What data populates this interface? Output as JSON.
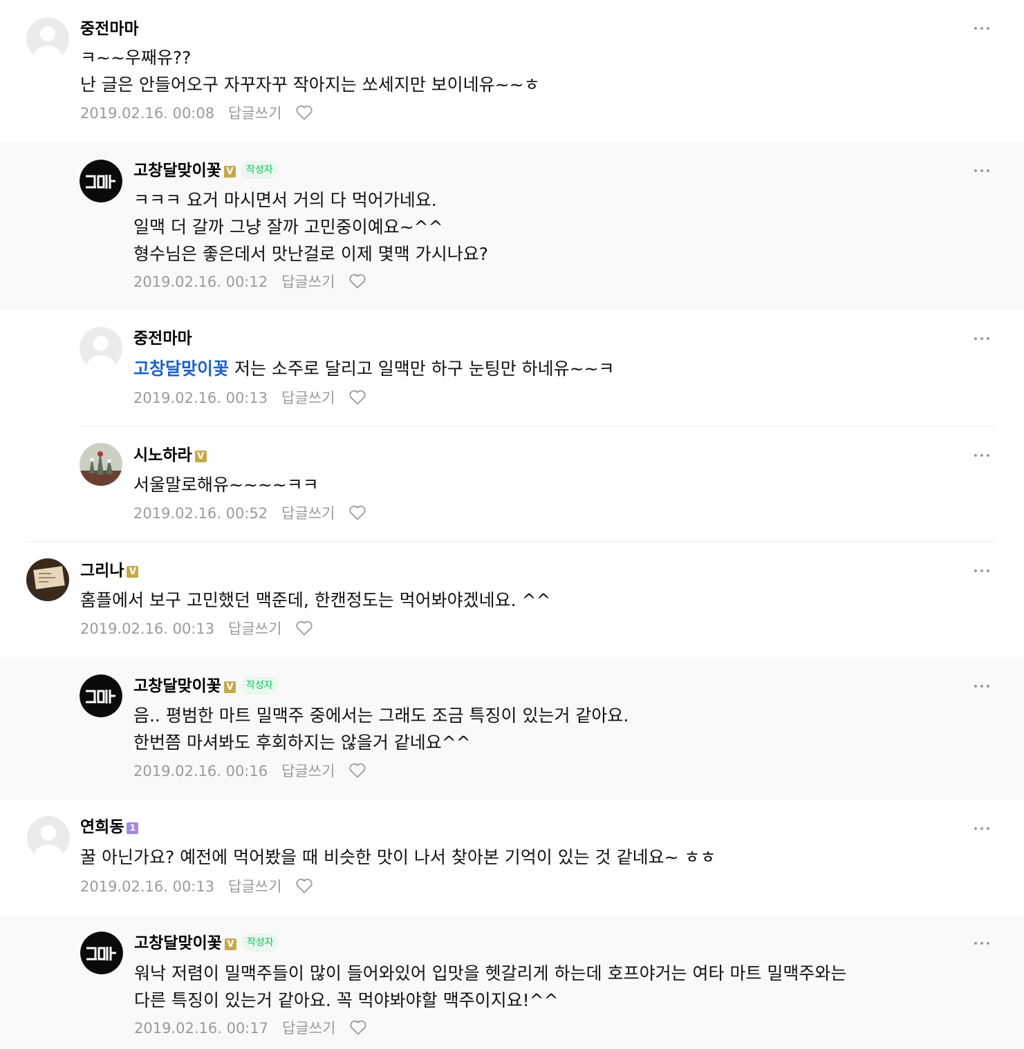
{
  "colors": {
    "reply_bg": "#f9f9f9",
    "mention": "#1a62cf",
    "author_tag": "#03c75a",
    "meta": "#9a9a9a"
  },
  "comments": [
    {
      "nick": "중전마마",
      "badge": "",
      "author_tag": "",
      "mention": "",
      "lines": [
        "ㅋ~~우째유??",
        "난 글은 안들어오구 자꾸자꾸 작아지는 쏘세지만 보이네유~~ㅎ"
      ],
      "date": "2019.02.16. 00:08",
      "reply": "답글쓰기"
    },
    {
      "nick": "고창달맞이꽃",
      "badge": "V",
      "author_tag": "작성자",
      "mention": "",
      "lines": [
        "ㅋㅋㅋ 요거 마시면서 거의 다 먹어가네요.",
        "일맥 더 갈까 그냥 잘까 고민중이예요~^^",
        "형수님은 좋은데서 맛난걸로 이제 몇맥 가시나요?"
      ],
      "date": "2019.02.16. 00:12",
      "reply": "답글쓰기"
    },
    {
      "nick": "중전마마",
      "badge": "",
      "author_tag": "",
      "mention": "고창달맞이꽃",
      "lines": [
        "저는 소주로 달리고 일맥만 하구 눈팅만 하네유~~ㅋ"
      ],
      "date": "2019.02.16. 00:13",
      "reply": "답글쓰기"
    },
    {
      "nick": "시노하라",
      "badge": "V",
      "author_tag": "",
      "mention": "",
      "lines": [
        "서울말로해유~~~~ㅋㅋ"
      ],
      "date": "2019.02.16. 00:52",
      "reply": "답글쓰기"
    },
    {
      "nick": "그리나",
      "badge": "V",
      "author_tag": "",
      "mention": "",
      "lines": [
        "홈플에서 보구 고민했던 맥준데, 한캔정도는 먹어봐야겠네요. ^^"
      ],
      "date": "2019.02.16. 00:13",
      "reply": "답글쓰기"
    },
    {
      "nick": "고창달맞이꽃",
      "badge": "V",
      "author_tag": "작성자",
      "mention": "",
      "lines": [
        "음.. 평범한 마트 밀맥주 중에서는 그래도 조금 특징이 있는거 같아요.",
        "한번쯤 마셔봐도 후회하지는 않을거 같네요^^"
      ],
      "date": "2019.02.16. 00:16",
      "reply": "답글쓰기"
    },
    {
      "nick": "연희동",
      "badge": "1",
      "author_tag": "",
      "mention": "",
      "lines": [
        "꿀 아닌가요? 예전에 먹어봤을 때 비슷한 맛이 나서 찾아본 기억이 있는 것 같네요~ ㅎㅎ"
      ],
      "date": "2019.02.16. 00:13",
      "reply": "답글쓰기"
    },
    {
      "nick": "고창달맞이꽃",
      "badge": "V",
      "author_tag": "작성자",
      "mention": "",
      "lines": [
        "워낙 저렴이 밀맥주들이 많이 들어와있어 입맛을 헷갈리게 하는데 호프야거는 여타 마트 밀맥주와는",
        "다른 특징이 있는거 같아요. 꼭 먹야봐야할 맥주이지요!^^"
      ],
      "date": "2019.02.16. 00:17",
      "reply": "답글쓰기"
    }
  ]
}
